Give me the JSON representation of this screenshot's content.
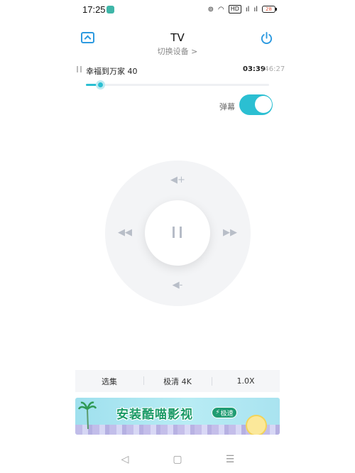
{
  "status_bar": {
    "time": "17:25",
    "signal_1": "ıl",
    "signal_2": "ıl",
    "hd_label": "HD",
    "battery": "28"
  },
  "header": {
    "title": "TV",
    "switch_device": "切换设备 >"
  },
  "player": {
    "title": "幸福到万家 40",
    "current_time": "03:39",
    "total_time": "/46:27",
    "progress": 0.079
  },
  "danmaku": {
    "label": "弹幕",
    "enabled": true
  },
  "dpad": {
    "up_icon": "volume-up-icon",
    "down_icon": "volume-down-icon",
    "left_icon": "rewind-icon",
    "right_icon": "fast-forward-icon",
    "center_icon": "pause-icon"
  },
  "options": [
    {
      "label": "选集"
    },
    {
      "label": "极清 4K"
    },
    {
      "label": "1.0X"
    }
  ],
  "ad": {
    "headline": "安装酷喵影视",
    "cta": "极速",
    "cta_icon": "⚡"
  },
  "nav": {
    "back": "◁",
    "home": "▢",
    "menu": "☰"
  },
  "colors": {
    "accent": "#2bbfd2",
    "header_icon": "#2d9ae0"
  }
}
